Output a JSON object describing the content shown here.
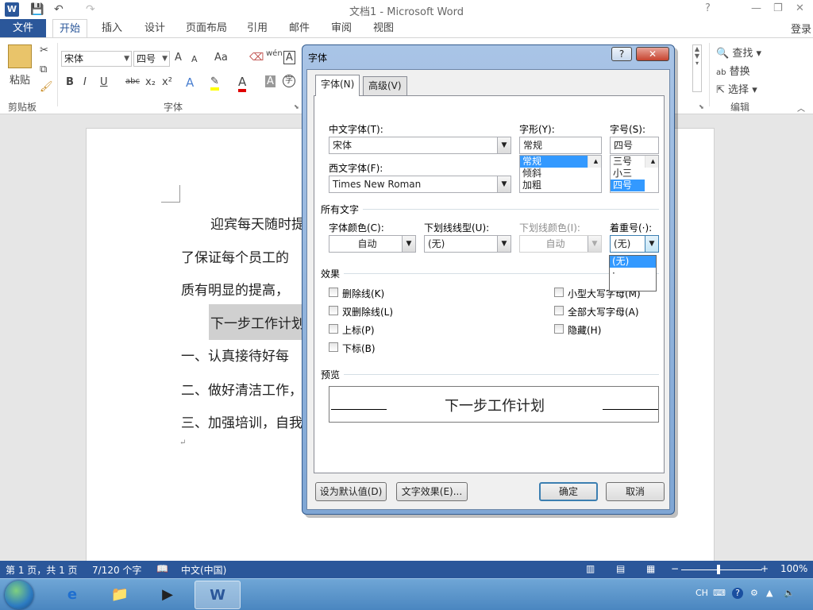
{
  "titlebar": {
    "title": "文档1 - Microsoft Word",
    "app_icon": "W",
    "qat_undo": "↶",
    "qat_redo": "↷",
    "help": "?",
    "min": "—",
    "restore": "❐",
    "close": "✕"
  },
  "tabs": {
    "file": "文件",
    "items": [
      "开始",
      "插入",
      "设计",
      "页面布局",
      "引用",
      "邮件",
      "审阅",
      "视图"
    ],
    "login": "登录"
  },
  "ribbon": {
    "clipboard_label": "剪贴板",
    "paste": "粘贴",
    "font_label": "字体",
    "font_name": "宋体",
    "font_size": "四号",
    "bold": "B",
    "italic": "I",
    "underline": "U",
    "strike": "abc",
    "sub": "x₂",
    "sup": "x²",
    "grow": "A",
    "shrink": "A",
    "case": "Aa",
    "pinyin": "wén",
    "charborder": "A",
    "editing_label": "编辑",
    "find": "查找",
    "replace": "替换",
    "select": "选择"
  },
  "document": {
    "lines": [
      {
        "text": "迎宾每天随时提",
        "hl": false
      },
      {
        "text": "了保证每个员工的",
        "hl": false
      },
      {
        "text": "质有明显的提高，",
        "hl": false
      },
      {
        "text": "下一步工作计划",
        "hl": true
      },
      {
        "text": "一、认真接待好每",
        "hl": false
      },
      {
        "text": "二、做好清洁工作，",
        "hl": false
      },
      {
        "text": "三、加强培训，自我",
        "hl": false
      }
    ],
    "para_mark": "↵"
  },
  "status": {
    "page": "第 1 页，共 1 页",
    "words": "7/120 个字",
    "lang": "中文(中国)",
    "zoom": "100%"
  },
  "taskbar": {
    "ime": "CH",
    "time_icon": "?"
  },
  "dialog": {
    "title": "字体",
    "tab_font": "字体(N)",
    "tab_advanced": "高级(V)",
    "cn_font_label": "中文字体(T):",
    "cn_font": "宋体",
    "west_font_label": "西文字体(F):",
    "west_font": "Times New Roman",
    "style_label": "字形(Y):",
    "style_value": "常规",
    "styles": [
      "常规",
      "倾斜",
      "加粗"
    ],
    "size_label": "字号(S):",
    "size_value": "四号",
    "sizes": [
      "三号",
      "小三",
      "四号"
    ],
    "all_text": "所有文字",
    "color_label": "字体颜色(C):",
    "color_value": "自动",
    "underline_label": "下划线线型(U):",
    "underline_value": "(无)",
    "ucolor_label": "下划线颜色(I):",
    "ucolor_value": "自动",
    "emphasis_label": "着重号(·):",
    "emphasis_value": "(无)",
    "emphasis_options": [
      "(无)",
      "·"
    ],
    "effects": "效果",
    "effect_items": [
      "删除线(K)",
      "双删除线(L)",
      "上标(P)",
      "下标(B)"
    ],
    "effect_items_right": [
      "小型大写字母(M)",
      "全部大写字母(A)",
      "隐藏(H)"
    ],
    "preview_label": "预览",
    "preview_text": "下一步工作计划",
    "btn_default": "设为默认值(D)",
    "btn_effects": "文字效果(E)...",
    "btn_ok": "确定",
    "btn_cancel": "取消"
  }
}
